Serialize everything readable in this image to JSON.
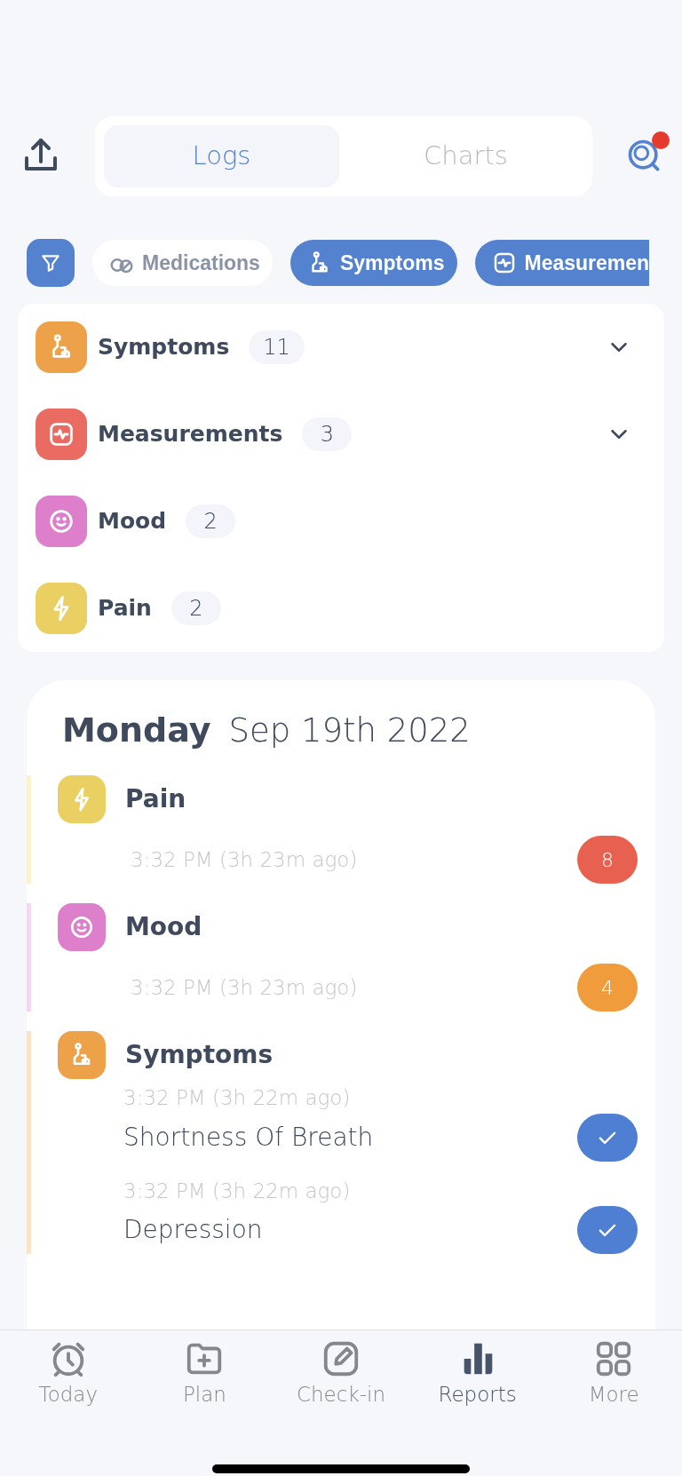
{
  "header": {
    "tabs": [
      {
        "label": "Logs",
        "selected": true
      },
      {
        "label": "Charts",
        "selected": false
      }
    ],
    "search": {
      "notification": true
    }
  },
  "filters": [
    {
      "label": "Medications",
      "kind": "medications",
      "selected": false
    },
    {
      "label": "Symptoms",
      "kind": "symptoms",
      "selected": true
    },
    {
      "label": "Measuremen",
      "kind": "measurements",
      "selected": true
    }
  ],
  "summary": [
    {
      "label": "Symptoms",
      "count": "11",
      "kind": "symptoms",
      "color": "#eda24a",
      "expandable": true
    },
    {
      "label": "Measurements",
      "count": "3",
      "kind": "measurements",
      "color": "#ea6b62",
      "expandable": true
    },
    {
      "label": "Mood",
      "count": "2",
      "kind": "mood",
      "color": "#de7fcc",
      "expandable": false
    },
    {
      "label": "Pain",
      "count": "2",
      "kind": "pain",
      "color": "#ead063",
      "expandable": false
    }
  ],
  "day": {
    "weekday": "Monday",
    "date": "Sep 19th 2022",
    "entries": [
      {
        "title": "Pain",
        "kind": "pain",
        "color": "#ead063",
        "time": "3:32 PM (3h 23m ago)",
        "badge": {
          "text": "8",
          "color": "#e8604f"
        }
      },
      {
        "title": "Mood",
        "kind": "mood",
        "color": "#de7fcc",
        "time": "3:32 PM (3h 23m ago)",
        "badge": {
          "text": "4",
          "color": "#f09b3c"
        }
      },
      {
        "title": "Symptoms",
        "kind": "symptoms",
        "color": "#eda24a",
        "items": [
          {
            "time": "3:32 PM (3h 22m ago)",
            "name": "Shortness Of Breath",
            "checked": true
          },
          {
            "time": "3:32 PM (3h 22m ago)",
            "name": "Depression",
            "checked": true
          }
        ]
      }
    ]
  },
  "nav": [
    {
      "label": "Today",
      "kind": "today",
      "selected": false
    },
    {
      "label": "Plan",
      "kind": "plan",
      "selected": false
    },
    {
      "label": "Check-in",
      "kind": "checkin",
      "selected": false
    },
    {
      "label": "Reports",
      "kind": "reports",
      "selected": true
    },
    {
      "label": "More",
      "kind": "more",
      "selected": false
    }
  ]
}
